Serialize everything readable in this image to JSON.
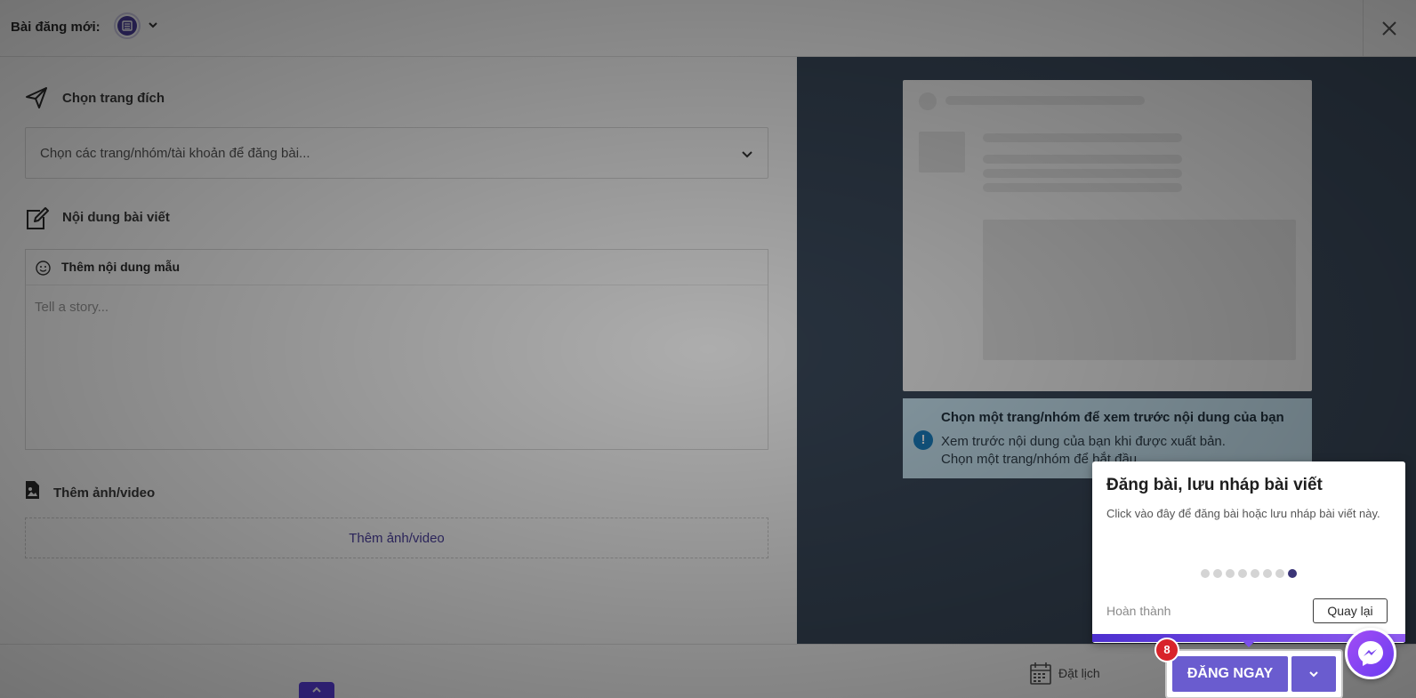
{
  "header": {
    "title": "Bài đăng mới:",
    "close_icon": "close-icon"
  },
  "target_section": {
    "label": "Chọn trang đích",
    "icon": "send-icon",
    "select_placeholder": "Chọn các trang/nhóm/tài khoản để đăng bài..."
  },
  "content_section": {
    "label": "Nội dung bài viết",
    "icon": "edit-icon",
    "template_label": "Thêm nội dung mẫu",
    "editor_placeholder": "Tell a story..."
  },
  "media_section": {
    "label": "Thêm ảnh/video",
    "icon": "image-file-icon",
    "button_label": "Thêm ảnh/video"
  },
  "preview": {
    "notice_title": "Chọn một trang/nhóm để xem trước nội dung của bạn",
    "notice_line1": "Xem trước nội dung của bạn khi được xuất bản.",
    "notice_line2": "Chọn một trang/nhóm để bắt đầu."
  },
  "footer": {
    "schedule_label": "Đặt lịch",
    "post_now_label": "ĐĂNG NGAY"
  },
  "tour": {
    "title": "Đăng bài, lưu nháp bài viết",
    "body": "Click vào đây để đăng bài hoặc lưu nháp bài viết này.",
    "finish_label": "Hoàn thành",
    "back_label": "Quay lại",
    "step_badge": "8",
    "total_steps": 8,
    "current_step": 8
  },
  "colors": {
    "accent": "#6a5ccf",
    "brand_dark": "#3b3577",
    "notice_bg": "#c9e6f4",
    "preview_bg": "#3b4a5c",
    "badge_red": "#d8232a"
  }
}
